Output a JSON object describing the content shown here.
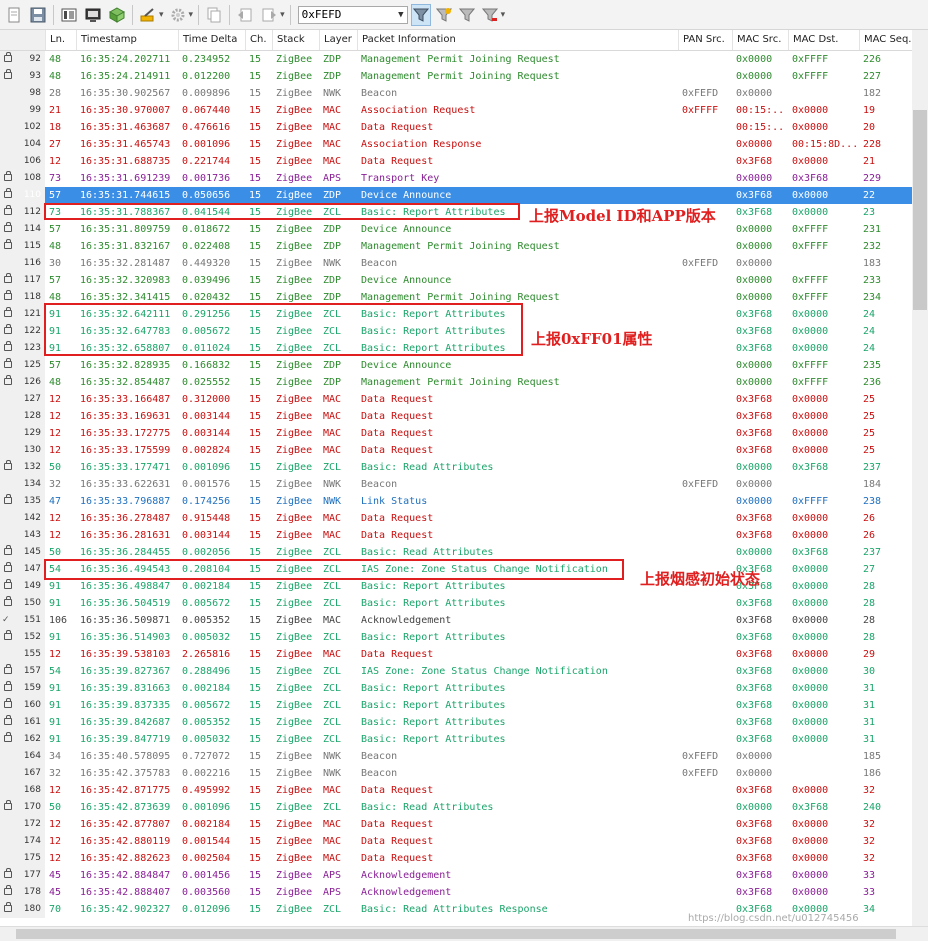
{
  "toolbar": {
    "filter_value": "0xFEFD"
  },
  "colors": {
    "zdp": "#2e8b2e",
    "zcl": "#1aa56a",
    "mac": "#c81010",
    "aps": "#8a2097",
    "nwk": "#777777",
    "nwk_link": "#1f70c0",
    "mac_ack": "#444444",
    "selected": "#3a8ee6"
  },
  "columns": [
    "Ln.",
    "Timestamp",
    "Time Delta",
    "Ch.",
    "Stack",
    "Layer",
    "Packet Information",
    "PAN Src.",
    "MAC Src.",
    "MAC Dst.",
    "MAC Seq."
  ],
  "rows": [
    {
      "id": "92",
      "ln": "48",
      "ts": "16:35:24.202711",
      "td": "0.234952",
      "ch": "15",
      "stack": "ZigBee",
      "layer": "ZDP",
      "info": "Management Permit Joining Request",
      "pan": "",
      "src": "0x0000",
      "dst": "0xFFFF",
      "seq": "226",
      "lock": true
    },
    {
      "id": "93",
      "ln": "48",
      "ts": "16:35:24.214911",
      "td": "0.012200",
      "ch": "15",
      "stack": "ZigBee",
      "layer": "ZDP",
      "info": "Management Permit Joining Request",
      "pan": "",
      "src": "0x0000",
      "dst": "0xFFFF",
      "seq": "227",
      "lock": true
    },
    {
      "id": "98",
      "ln": "28",
      "ts": "16:35:30.902567",
      "td": "0.009896",
      "ch": "15",
      "stack": "ZigBee",
      "layer": "NWK",
      "info": "Beacon",
      "pan": "0xFEFD",
      "src": "0x0000",
      "dst": "",
      "seq": "182",
      "lock": false
    },
    {
      "id": "99",
      "ln": "21",
      "ts": "16:35:30.970007",
      "td": "0.067440",
      "ch": "15",
      "stack": "ZigBee",
      "layer": "MAC",
      "info": "Association Request",
      "pan": "0xFFFF",
      "src": "00:15:..",
      "dst": "0x0000",
      "seq": "19",
      "lock": false
    },
    {
      "id": "102",
      "ln": "18",
      "ts": "16:35:31.463687",
      "td": "0.476616",
      "ch": "15",
      "stack": "ZigBee",
      "layer": "MAC",
      "info": "Data Request",
      "pan": "",
      "src": "00:15:..",
      "dst": "0x0000",
      "seq": "20",
      "lock": false
    },
    {
      "id": "104",
      "ln": "27",
      "ts": "16:35:31.465743",
      "td": "0.001096",
      "ch": "15",
      "stack": "ZigBee",
      "layer": "MAC",
      "info": "Association Response",
      "pan": "",
      "src": "0x0000",
      "dst": "00:15:8D...",
      "seq": "228",
      "lock": false
    },
    {
      "id": "106",
      "ln": "12",
      "ts": "16:35:31.688735",
      "td": "0.221744",
      "ch": "15",
      "stack": "ZigBee",
      "layer": "MAC",
      "info": "Data Request",
      "pan": "",
      "src": "0x3F68",
      "dst": "0x0000",
      "seq": "21",
      "lock": false
    },
    {
      "id": "108",
      "ln": "73",
      "ts": "16:35:31.691239",
      "td": "0.001736",
      "ch": "15",
      "stack": "ZigBee",
      "layer": "APS",
      "info": "Transport Key",
      "pan": "",
      "src": "0x0000",
      "dst": "0x3F68",
      "seq": "229",
      "lock": true
    },
    {
      "id": "110",
      "ln": "57",
      "ts": "16:35:31.744615",
      "td": "0.050656",
      "ch": "15",
      "stack": "ZigBee",
      "layer": "ZDP",
      "info": "Device Announce",
      "pan": "",
      "src": "0x3F68",
      "dst": "0x0000",
      "seq": "22",
      "lock": true,
      "sel": true
    },
    {
      "id": "112",
      "ln": "73",
      "ts": "16:35:31.788367",
      "td": "0.041544",
      "ch": "15",
      "stack": "ZigBee",
      "layer": "ZCL",
      "info": "Basic: Report Attributes",
      "pan": "",
      "src": "0x3F68",
      "dst": "0x0000",
      "seq": "23",
      "lock": true
    },
    {
      "id": "114",
      "ln": "57",
      "ts": "16:35:31.809759",
      "td": "0.018672",
      "ch": "15",
      "stack": "ZigBee",
      "layer": "ZDP",
      "info": "Device Announce",
      "pan": "",
      "src": "0x0000",
      "dst": "0xFFFF",
      "seq": "231",
      "lock": true
    },
    {
      "id": "115",
      "ln": "48",
      "ts": "16:35:31.832167",
      "td": "0.022408",
      "ch": "15",
      "stack": "ZigBee",
      "layer": "ZDP",
      "info": "Management Permit Joining Request",
      "pan": "",
      "src": "0x0000",
      "dst": "0xFFFF",
      "seq": "232",
      "lock": true
    },
    {
      "id": "116",
      "ln": "30",
      "ts": "16:35:32.281487",
      "td": "0.449320",
      "ch": "15",
      "stack": "ZigBee",
      "layer": "NWK",
      "info": "Beacon",
      "pan": "0xFEFD",
      "src": "0x0000",
      "dst": "",
      "seq": "183",
      "lock": false
    },
    {
      "id": "117",
      "ln": "57",
      "ts": "16:35:32.320983",
      "td": "0.039496",
      "ch": "15",
      "stack": "ZigBee",
      "layer": "ZDP",
      "info": "Device Announce",
      "pan": "",
      "src": "0x0000",
      "dst": "0xFFFF",
      "seq": "233",
      "lock": true
    },
    {
      "id": "118",
      "ln": "48",
      "ts": "16:35:32.341415",
      "td": "0.020432",
      "ch": "15",
      "stack": "ZigBee",
      "layer": "ZDP",
      "info": "Management Permit Joining Request",
      "pan": "",
      "src": "0x0000",
      "dst": "0xFFFF",
      "seq": "234",
      "lock": true
    },
    {
      "id": "121",
      "ln": "91",
      "ts": "16:35:32.642111",
      "td": "0.291256",
      "ch": "15",
      "stack": "ZigBee",
      "layer": "ZCL",
      "info": "Basic: Report Attributes",
      "pan": "",
      "src": "0x3F68",
      "dst": "0x0000",
      "seq": "24",
      "lock": true
    },
    {
      "id": "122",
      "ln": "91",
      "ts": "16:35:32.647783",
      "td": "0.005672",
      "ch": "15",
      "stack": "ZigBee",
      "layer": "ZCL",
      "info": "Basic: Report Attributes",
      "pan": "",
      "src": "0x3F68",
      "dst": "0x0000",
      "seq": "24",
      "lock": true
    },
    {
      "id": "123",
      "ln": "91",
      "ts": "16:35:32.658807",
      "td": "0.011024",
      "ch": "15",
      "stack": "ZigBee",
      "layer": "ZCL",
      "info": "Basic: Report Attributes",
      "pan": "",
      "src": "0x3F68",
      "dst": "0x0000",
      "seq": "24",
      "lock": true
    },
    {
      "id": "125",
      "ln": "57",
      "ts": "16:35:32.828935",
      "td": "0.166832",
      "ch": "15",
      "stack": "ZigBee",
      "layer": "ZDP",
      "info": "Device Announce",
      "pan": "",
      "src": "0x0000",
      "dst": "0xFFFF",
      "seq": "235",
      "lock": true
    },
    {
      "id": "126",
      "ln": "48",
      "ts": "16:35:32.854487",
      "td": "0.025552",
      "ch": "15",
      "stack": "ZigBee",
      "layer": "ZDP",
      "info": "Management Permit Joining Request",
      "pan": "",
      "src": "0x0000",
      "dst": "0xFFFF",
      "seq": "236",
      "lock": true
    },
    {
      "id": "127",
      "ln": "12",
      "ts": "16:35:33.166487",
      "td": "0.312000",
      "ch": "15",
      "stack": "ZigBee",
      "layer": "MAC",
      "info": "Data Request",
      "pan": "",
      "src": "0x3F68",
      "dst": "0x0000",
      "seq": "25",
      "lock": false
    },
    {
      "id": "128",
      "ln": "12",
      "ts": "16:35:33.169631",
      "td": "0.003144",
      "ch": "15",
      "stack": "ZigBee",
      "layer": "MAC",
      "info": "Data Request",
      "pan": "",
      "src": "0x3F68",
      "dst": "0x0000",
      "seq": "25",
      "lock": false
    },
    {
      "id": "129",
      "ln": "12",
      "ts": "16:35:33.172775",
      "td": "0.003144",
      "ch": "15",
      "stack": "ZigBee",
      "layer": "MAC",
      "info": "Data Request",
      "pan": "",
      "src": "0x3F68",
      "dst": "0x0000",
      "seq": "25",
      "lock": false
    },
    {
      "id": "130",
      "ln": "12",
      "ts": "16:35:33.175599",
      "td": "0.002824",
      "ch": "15",
      "stack": "ZigBee",
      "layer": "MAC",
      "info": "Data Request",
      "pan": "",
      "src": "0x3F68",
      "dst": "0x0000",
      "seq": "25",
      "lock": false
    },
    {
      "id": "132",
      "ln": "50",
      "ts": "16:35:33.177471",
      "td": "0.001096",
      "ch": "15",
      "stack": "ZigBee",
      "layer": "ZCL",
      "info": "Basic: Read Attributes",
      "pan": "",
      "src": "0x0000",
      "dst": "0x3F68",
      "seq": "237",
      "lock": true
    },
    {
      "id": "134",
      "ln": "32",
      "ts": "16:35:33.622631",
      "td": "0.001576",
      "ch": "15",
      "stack": "ZigBee",
      "layer": "NWK",
      "info": "Beacon",
      "pan": "0xFEFD",
      "src": "0x0000",
      "dst": "",
      "seq": "184",
      "lock": false
    },
    {
      "id": "135",
      "ln": "47",
      "ts": "16:35:33.796887",
      "td": "0.174256",
      "ch": "15",
      "stack": "ZigBee",
      "layer": "NWK",
      "info": "Link Status",
      "pan": "",
      "src": "0x0000",
      "dst": "0xFFFF",
      "seq": "238",
      "lock": true,
      "link": true
    },
    {
      "id": "142",
      "ln": "12",
      "ts": "16:35:36.278487",
      "td": "0.915448",
      "ch": "15",
      "stack": "ZigBee",
      "layer": "MAC",
      "info": "Data Request",
      "pan": "",
      "src": "0x3F68",
      "dst": "0x0000",
      "seq": "26",
      "lock": false
    },
    {
      "id": "143",
      "ln": "12",
      "ts": "16:35:36.281631",
      "td": "0.003144",
      "ch": "15",
      "stack": "ZigBee",
      "layer": "MAC",
      "info": "Data Request",
      "pan": "",
      "src": "0x3F68",
      "dst": "0x0000",
      "seq": "26",
      "lock": false
    },
    {
      "id": "145",
      "ln": "50",
      "ts": "16:35:36.284455",
      "td": "0.002056",
      "ch": "15",
      "stack": "ZigBee",
      "layer": "ZCL",
      "info": "Basic: Read Attributes",
      "pan": "",
      "src": "0x0000",
      "dst": "0x3F68",
      "seq": "237",
      "lock": true
    },
    {
      "id": "147",
      "ln": "54",
      "ts": "16:35:36.494543",
      "td": "0.208104",
      "ch": "15",
      "stack": "ZigBee",
      "layer": "ZCL",
      "info": "IAS Zone: Zone Status Change Notification",
      "pan": "",
      "src": "0x3F68",
      "dst": "0x0000",
      "seq": "27",
      "lock": true
    },
    {
      "id": "149",
      "ln": "91",
      "ts": "16:35:36.498847",
      "td": "0.002184",
      "ch": "15",
      "stack": "ZigBee",
      "layer": "ZCL",
      "info": "Basic: Report Attributes",
      "pan": "",
      "src": "0x3F68",
      "dst": "0x0000",
      "seq": "28",
      "lock": true
    },
    {
      "id": "150",
      "ln": "91",
      "ts": "16:35:36.504519",
      "td": "0.005672",
      "ch": "15",
      "stack": "ZigBee",
      "layer": "ZCL",
      "info": "Basic: Report Attributes",
      "pan": "",
      "src": "0x3F68",
      "dst": "0x0000",
      "seq": "28",
      "lock": true
    },
    {
      "id": "151",
      "ln": "106",
      "ts": "16:35:36.509871",
      "td": "0.005352",
      "ch": "15",
      "stack": "ZigBee",
      "layer": "MAC",
      "info": "Acknowledgement",
      "pan": "",
      "src": "0x3F68",
      "dst": "0x0000",
      "seq": "28",
      "lock": false,
      "ack": true
    },
    {
      "id": "152",
      "ln": "91",
      "ts": "16:35:36.514903",
      "td": "0.005032",
      "ch": "15",
      "stack": "ZigBee",
      "layer": "ZCL",
      "info": "Basic: Report Attributes",
      "pan": "",
      "src": "0x3F68",
      "dst": "0x0000",
      "seq": "28",
      "lock": true
    },
    {
      "id": "155",
      "ln": "12",
      "ts": "16:35:39.538103",
      "td": "2.265816",
      "ch": "15",
      "stack": "ZigBee",
      "layer": "MAC",
      "info": "Data Request",
      "pan": "",
      "src": "0x3F68",
      "dst": "0x0000",
      "seq": "29",
      "lock": false
    },
    {
      "id": "157",
      "ln": "54",
      "ts": "16:35:39.827367",
      "td": "0.288496",
      "ch": "15",
      "stack": "ZigBee",
      "layer": "ZCL",
      "info": "IAS Zone: Zone Status Change Notification",
      "pan": "",
      "src": "0x3F68",
      "dst": "0x0000",
      "seq": "30",
      "lock": true
    },
    {
      "id": "159",
      "ln": "91",
      "ts": "16:35:39.831663",
      "td": "0.002184",
      "ch": "15",
      "stack": "ZigBee",
      "layer": "ZCL",
      "info": "Basic: Report Attributes",
      "pan": "",
      "src": "0x3F68",
      "dst": "0x0000",
      "seq": "31",
      "lock": true
    },
    {
      "id": "160",
      "ln": "91",
      "ts": "16:35:39.837335",
      "td": "0.005672",
      "ch": "15",
      "stack": "ZigBee",
      "layer": "ZCL",
      "info": "Basic: Report Attributes",
      "pan": "",
      "src": "0x3F68",
      "dst": "0x0000",
      "seq": "31",
      "lock": true
    },
    {
      "id": "161",
      "ln": "91",
      "ts": "16:35:39.842687",
      "td": "0.005352",
      "ch": "15",
      "stack": "ZigBee",
      "layer": "ZCL",
      "info": "Basic: Report Attributes",
      "pan": "",
      "src": "0x3F68",
      "dst": "0x0000",
      "seq": "31",
      "lock": true
    },
    {
      "id": "162",
      "ln": "91",
      "ts": "16:35:39.847719",
      "td": "0.005032",
      "ch": "15",
      "stack": "ZigBee",
      "layer": "ZCL",
      "info": "Basic: Report Attributes",
      "pan": "",
      "src": "0x3F68",
      "dst": "0x0000",
      "seq": "31",
      "lock": true
    },
    {
      "id": "164",
      "ln": "34",
      "ts": "16:35:40.578095",
      "td": "0.727072",
      "ch": "15",
      "stack": "ZigBee",
      "layer": "NWK",
      "info": "Beacon",
      "pan": "0xFEFD",
      "src": "0x0000",
      "dst": "",
      "seq": "185",
      "lock": false
    },
    {
      "id": "167",
      "ln": "32",
      "ts": "16:35:42.375783",
      "td": "0.002216",
      "ch": "15",
      "stack": "ZigBee",
      "layer": "NWK",
      "info": "Beacon",
      "pan": "0xFEFD",
      "src": "0x0000",
      "dst": "",
      "seq": "186",
      "lock": false
    },
    {
      "id": "168",
      "ln": "12",
      "ts": "16:35:42.871775",
      "td": "0.495992",
      "ch": "15",
      "stack": "ZigBee",
      "layer": "MAC",
      "info": "Data Request",
      "pan": "",
      "src": "0x3F68",
      "dst": "0x0000",
      "seq": "32",
      "lock": false
    },
    {
      "id": "170",
      "ln": "50",
      "ts": "16:35:42.873639",
      "td": "0.001096",
      "ch": "15",
      "stack": "ZigBee",
      "layer": "ZCL",
      "info": "Basic: Read Attributes",
      "pan": "",
      "src": "0x0000",
      "dst": "0x3F68",
      "seq": "240",
      "lock": true
    },
    {
      "id": "172",
      "ln": "12",
      "ts": "16:35:42.877807",
      "td": "0.002184",
      "ch": "15",
      "stack": "ZigBee",
      "layer": "MAC",
      "info": "Data Request",
      "pan": "",
      "src": "0x3F68",
      "dst": "0x0000",
      "seq": "32",
      "lock": false
    },
    {
      "id": "174",
      "ln": "12",
      "ts": "16:35:42.880119",
      "td": "0.001544",
      "ch": "15",
      "stack": "ZigBee",
      "layer": "MAC",
      "info": "Data Request",
      "pan": "",
      "src": "0x3F68",
      "dst": "0x0000",
      "seq": "32",
      "lock": false
    },
    {
      "id": "175",
      "ln": "12",
      "ts": "16:35:42.882623",
      "td": "0.002504",
      "ch": "15",
      "stack": "ZigBee",
      "layer": "MAC",
      "info": "Data Request",
      "pan": "",
      "src": "0x3F68",
      "dst": "0x0000",
      "seq": "32",
      "lock": false
    },
    {
      "id": "177",
      "ln": "45",
      "ts": "16:35:42.884847",
      "td": "0.001456",
      "ch": "15",
      "stack": "ZigBee",
      "layer": "APS",
      "info": "Acknowledgement",
      "pan": "",
      "src": "0x3F68",
      "dst": "0x0000",
      "seq": "33",
      "lock": true
    },
    {
      "id": "178",
      "ln": "45",
      "ts": "16:35:42.888407",
      "td": "0.003560",
      "ch": "15",
      "stack": "ZigBee",
      "layer": "APS",
      "info": "Acknowledgement",
      "pan": "",
      "src": "0x3F68",
      "dst": "0x0000",
      "seq": "33",
      "lock": true
    },
    {
      "id": "180",
      "ln": "70",
      "ts": "16:35:42.902327",
      "td": "0.012096",
      "ch": "15",
      "stack": "ZigBee",
      "layer": "ZCL",
      "info": "Basic: Read Attributes Response",
      "pan": "",
      "src": "0x3F68",
      "dst": "0x0000",
      "seq": "34",
      "lock": true
    }
  ],
  "annotations": {
    "note1": "上报Model ID和APP版本",
    "note2": "上报0xFF01属性",
    "note3": "上报烟感初始状态"
  },
  "watermark": "https://blog.csdn.net/u012745456"
}
